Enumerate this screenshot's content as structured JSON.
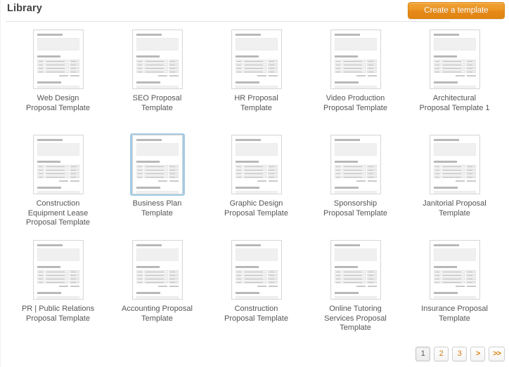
{
  "header": {
    "title": "Library",
    "create_button_label": "Create a template"
  },
  "colors": {
    "accent_orange": "#e5891a",
    "button_border": "#d98310",
    "selection_blue": "#a3cbe4",
    "text": "#555555",
    "title_text": "#444444",
    "divider": "#e2e2e2",
    "thumb_border": "#d8d8d8",
    "thumb_block": "#f0f0f0"
  },
  "library": {
    "templates": [
      {
        "name": "Web Design\nProposal Template",
        "selected": false
      },
      {
        "name": "SEO Proposal\nTemplate",
        "selected": false
      },
      {
        "name": "HR Proposal\nTemplate",
        "selected": false
      },
      {
        "name": "Video Production\nProposal Template",
        "selected": false
      },
      {
        "name": "Architectural\nProposal Template 1",
        "selected": false
      },
      {
        "name": "Construction\nEquipment Lease\nProposal Template",
        "selected": false
      },
      {
        "name": "Business Plan\nTemplate",
        "selected": true
      },
      {
        "name": "Graphic Design\nProposal Template",
        "selected": false
      },
      {
        "name": "Sponsorship\nProposal Template",
        "selected": false
      },
      {
        "name": "Janitorial Proposal\nTemplate",
        "selected": false
      },
      {
        "name": "PR | Public Relations\nProposal Template",
        "selected": false
      },
      {
        "name": "Accounting Proposal\nTemplate",
        "selected": false
      },
      {
        "name": "Construction\nProposal Template",
        "selected": false
      },
      {
        "name": "Online Tutoring\nServices Proposal\nTemplate",
        "selected": false
      },
      {
        "name": "Insurance Proposal\nTemplate",
        "selected": false
      }
    ]
  },
  "pagination": {
    "pages": [
      {
        "label": "1",
        "active": true,
        "nav": false
      },
      {
        "label": "2",
        "active": false,
        "nav": false
      },
      {
        "label": "3",
        "active": false,
        "nav": false
      },
      {
        "label": ">",
        "active": false,
        "nav": true
      },
      {
        "label": ">>",
        "active": false,
        "nav": true
      }
    ]
  }
}
